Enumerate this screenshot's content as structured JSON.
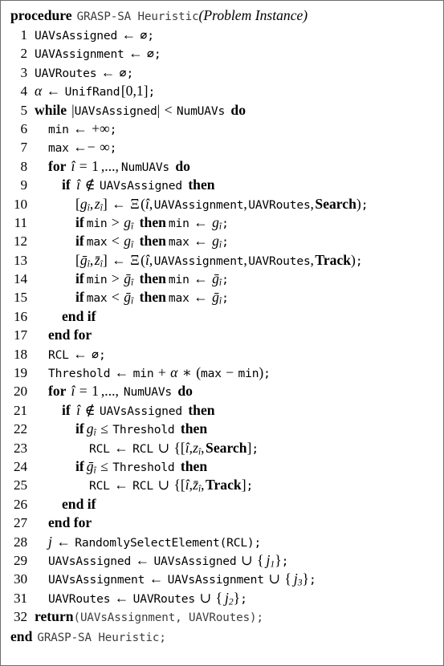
{
  "algorithm": {
    "header": {
      "keyword": "procedure",
      "name": "GRASP-SA Heuristic",
      "argument": "(Problem Instance)"
    },
    "footer": {
      "keyword": "end",
      "name": "GRASP-SA Heuristic;"
    },
    "lines": [
      {
        "no": "1",
        "indent": 0,
        "text": "UAVsAssigned ← ∅;"
      },
      {
        "no": "2",
        "indent": 0,
        "text": "UAVAssignment ← ∅;"
      },
      {
        "no": "3",
        "indent": 0,
        "text": "UAVRoutes ← ∅;"
      },
      {
        "no": "4",
        "indent": 0,
        "text": "α ← UnifRand [0,1];"
      },
      {
        "no": "5",
        "indent": 0,
        "text": "while |UAVsAssigned| < NumUAVs do"
      },
      {
        "no": "6",
        "indent": 1,
        "text": "min ← +∞;"
      },
      {
        "no": "7",
        "indent": 1,
        "text": "max ←− ∞;"
      },
      {
        "no": "8",
        "indent": 1,
        "text": "for î = 1,..., NumUAVs do"
      },
      {
        "no": "9",
        "indent": 2,
        "text": "if î ∉ UAVsAssigned then"
      },
      {
        "no": "10",
        "indent": 3,
        "text": "[gî, zî] ← Ξ(î, UAVAssignment, UAVRoutes, Search);"
      },
      {
        "no": "11",
        "indent": 3,
        "text": "if min > gî then min ← gî;"
      },
      {
        "no": "12",
        "indent": 3,
        "text": "if max < gî then max ← gî;"
      },
      {
        "no": "13",
        "indent": 3,
        "text": "[ḡî, z̄î] ← Ξ(î, UAVAssignment, UAVRoutes, Track);"
      },
      {
        "no": "14",
        "indent": 3,
        "text": "if min > ḡî then min ← ḡî;"
      },
      {
        "no": "15",
        "indent": 3,
        "text": "if max < ḡî then max ← ḡî;"
      },
      {
        "no": "16",
        "indent": 2,
        "text": "end if"
      },
      {
        "no": "17",
        "indent": 1,
        "text": "end for"
      },
      {
        "no": "18",
        "indent": 1,
        "text": "RCL ← ∅;"
      },
      {
        "no": "19",
        "indent": 1,
        "text": "Threshold ← min + α ∗ (max − min);"
      },
      {
        "no": "20",
        "indent": 1,
        "text": "for î = 1,..., NumUAVs do"
      },
      {
        "no": "21",
        "indent": 2,
        "text": "if î ∉ UAVsAssigned then"
      },
      {
        "no": "22",
        "indent": 3,
        "text": "if gî ≤ Threshold then"
      },
      {
        "no": "23",
        "indent": 4,
        "text": "RCL ← RCL ∪ {[î,zî, Search];"
      },
      {
        "no": "24",
        "indent": 3,
        "text": "if ḡî ≤ Threshold then"
      },
      {
        "no": "25",
        "indent": 4,
        "text": "RCL ← RCL ∪ {[î,z̄î, Track];"
      },
      {
        "no": "26",
        "indent": 2,
        "text": "end if"
      },
      {
        "no": "27",
        "indent": 1,
        "text": "end for"
      },
      {
        "no": "28",
        "indent": 1,
        "text": "j ← RandomlySelectElement(RCL);"
      },
      {
        "no": "29",
        "indent": 1,
        "text": "UAVsAssigned ← UAVsAssigned ∪ { j1};"
      },
      {
        "no": "30",
        "indent": 1,
        "text": "UAVsAssignment ← UAVsAssignment ∪ { j3};"
      },
      {
        "no": "31",
        "indent": 1,
        "text": "UAVRoutes ← UAVRoutes ∪ { j2};"
      },
      {
        "no": "32",
        "indent": 0,
        "text": "return(UAVsAssignment, UAVRoutes);"
      }
    ]
  }
}
